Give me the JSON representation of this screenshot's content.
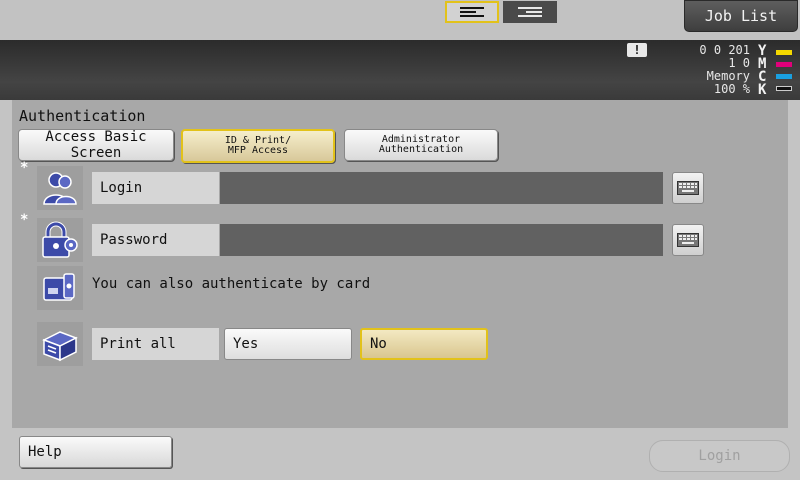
{
  "header": {
    "job_list_label": "Job List"
  },
  "status": {
    "counter_lines": [
      "0 0 201",
      "1 0",
      "Memory",
      "100 %"
    ],
    "toner": [
      {
        "letter": "Y",
        "color": "#f4d800"
      },
      {
        "letter": "M",
        "color": "#e0007a"
      },
      {
        "letter": "C",
        "color": "#1aa0e0"
      },
      {
        "letter": "K",
        "color": "#111111"
      }
    ]
  },
  "authentication": {
    "title": "Authentication",
    "tabs": {
      "basic": "Access Basic Screen",
      "idprint_line1": "ID & Print/",
      "idprint_line2": "MFP Access",
      "admin_line1": "Administrator",
      "admin_line2": "Authentication"
    },
    "required_mark": "*",
    "login_label": "Login",
    "login_value": "",
    "password_label": "Password",
    "password_value": "",
    "card_text": "You can also authenticate by card",
    "print_all_label": "Print all",
    "yes_label": "Yes",
    "no_label": "No",
    "selected_print_all": "No"
  },
  "footer": {
    "help_label": "Help",
    "login_button_label": "Login"
  }
}
